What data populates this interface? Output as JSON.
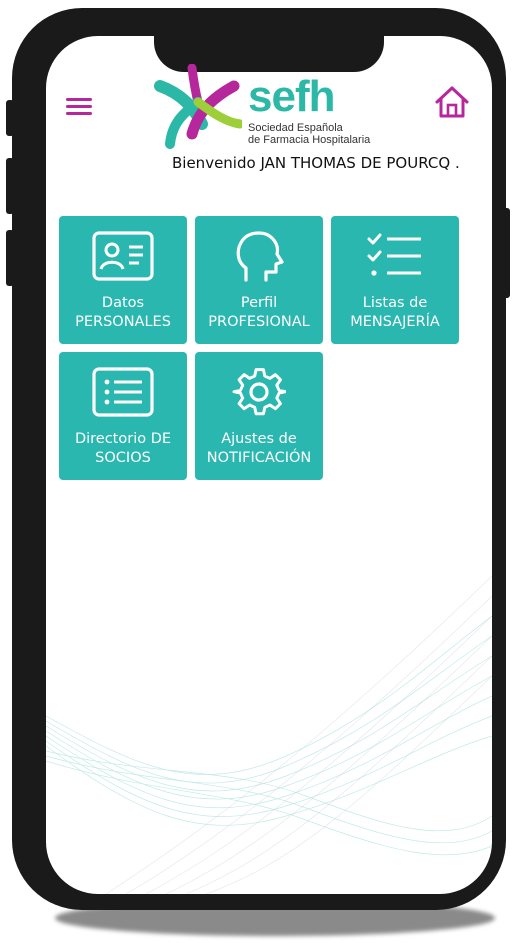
{
  "header": {
    "menu_icon": "hamburger-menu-icon",
    "home_icon": "home-icon",
    "logo": {
      "name": "sefh",
      "subtitle_line1": "Sociedad Española",
      "subtitle_line2": "de Farmacia Hospitalaria"
    },
    "welcome": "Bienvenido JAN THOMAS DE POURCQ ."
  },
  "tiles": [
    {
      "icon": "id-card-icon",
      "line1": "Datos",
      "line2": "PERSONALES"
    },
    {
      "icon": "head-profile-icon",
      "line1": "Perfil",
      "line2": "PROFESIONAL"
    },
    {
      "icon": "checklist-icon",
      "line1": "Listas de",
      "line2": "MENSAJERÍA"
    },
    {
      "icon": "list-document-icon",
      "line1": "Directorio DE",
      "line2": "SOCIOS"
    },
    {
      "icon": "gear-icon",
      "line1": "Ajustes de",
      "line2": "NOTIFICACIÓN"
    }
  ],
  "colors": {
    "tile": "#2ab7b0",
    "accent_magenta": "#b5279a",
    "logo_teal": "#2bb8a6",
    "phone_frame": "#1a1a1a"
  }
}
